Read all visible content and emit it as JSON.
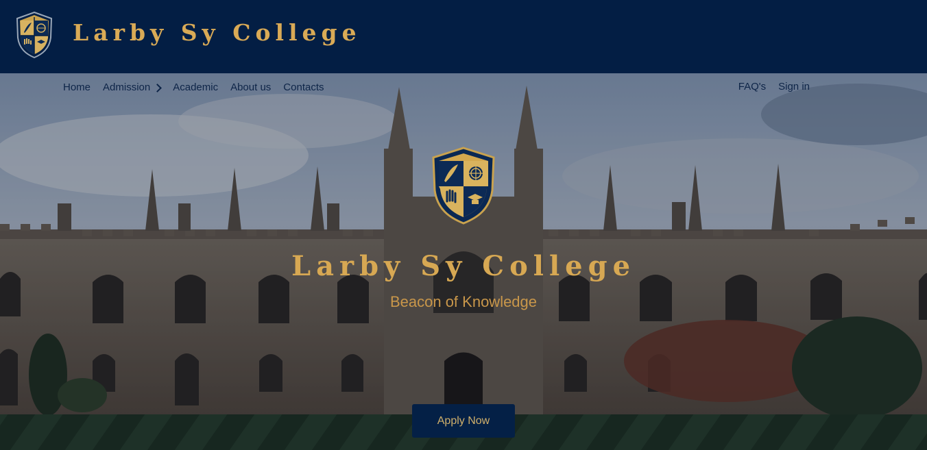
{
  "header": {
    "brand": "Larby Sy College",
    "logo_icon": "shield-crest-icon"
  },
  "nav": {
    "left": [
      {
        "label": "Home"
      },
      {
        "label": "Admission"
      },
      {
        "label": "Academic"
      },
      {
        "label": "About us"
      },
      {
        "label": "Contacts"
      }
    ],
    "right": [
      {
        "label": "FAQ's"
      },
      {
        "label": "Sign in"
      }
    ],
    "dropdown_icon": "chevron-right-icon"
  },
  "hero": {
    "title": "Larby Sy College",
    "tagline": "Beacon of Knowledge",
    "cta_label": "Apply Now",
    "crest_icon": "shield-crest-icon",
    "background_image": "college-building-photo"
  },
  "colors": {
    "header_bg": "#031e44",
    "gold": "#d9aa56",
    "nav_text": "#0d2447",
    "button_bg": "#042046"
  }
}
